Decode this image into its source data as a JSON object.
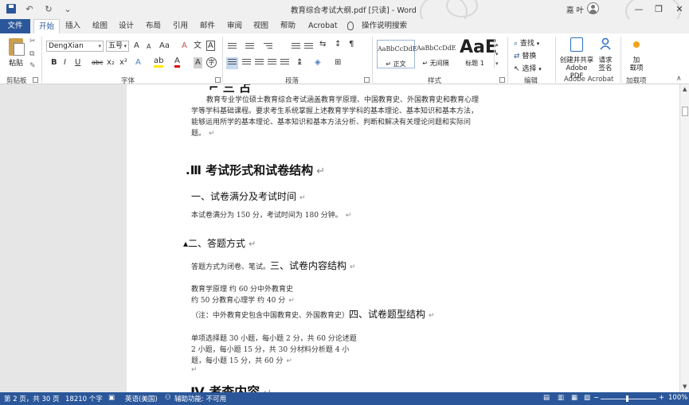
{
  "window": {
    "title": "教育综合考试大纲.pdf [只读] - Word",
    "user": "嘉 叶",
    "controls": {
      "minimize": "—",
      "restore": "❐",
      "close": "✕"
    }
  },
  "qat": {
    "undo": "↶",
    "redo": "↻",
    "more": "⌄"
  },
  "tabs": [
    "文件",
    "开始",
    "插入",
    "绘图",
    "设计",
    "布局",
    "引用",
    "邮件",
    "审阅",
    "视图",
    "帮助",
    "Acrobat",
    "操作说明搜索"
  ],
  "ribbon": {
    "clipboard": {
      "paste": "粘贴",
      "label": "剪贴板"
    },
    "font": {
      "name": "DengXian",
      "size": "五号",
      "grow": "A",
      "shrink": "A",
      "case": "Aa",
      "clear": "A",
      "phonetic": "文",
      "border_char": "A",
      "bold": "B",
      "italic": "I",
      "underline": "U",
      "strike": "abc",
      "subscript": "x₂",
      "superscript": "x²",
      "effects": "A",
      "highlight": "ab",
      "color": "A",
      "shade": "A",
      "circle": "字",
      "label": "字体"
    },
    "paragraph": {
      "label": "段落"
    },
    "styles": {
      "items": [
        {
          "sample": "AaBbCcDdE",
          "name": "↵ 正文"
        },
        {
          "sample": "AaBbCcDdE",
          "name": "↵ 无间隔"
        },
        {
          "sample": "AaE",
          "name": "标题 1"
        }
      ],
      "label": "样式"
    },
    "editing": {
      "find": "查找",
      "replace": "替换",
      "select": "选择",
      "label": "编辑"
    },
    "acrobat": {
      "create_line1": "创建并共享",
      "create_line2": "Adobe PDF",
      "sign_line1": "请求",
      "sign_line2": "签名",
      "label": "Adobe Acrobat"
    },
    "addins": {
      "line1": "加",
      "line2": "载项",
      "label": "加载项"
    }
  },
  "document": {
    "intro_lines": [
      "教育专业学位硕士教育综合考试涵盖教育学原理、中国教育史、外国教育史和教育心理",
      "学等学科基础课程。要求考生系统掌握上述教育学学科的基本理论、基本知识和基本方法，",
      "能够运用所学的基本理论、基本知识和基本方法分析、判断和解决有关理论问题和实际问",
      "题。"
    ],
    "section3_title": "Ⅲ 考试形式和试卷结构",
    "h_full_marks": "一、试卷满分及考试时间",
    "full_marks_text": "本试卷满分为 150 分，考试时间为 180 分钟。",
    "h_answer_mode": "二、答题方式",
    "answer_mode_text": "答题方式为闭卷、笔试。",
    "h_content": "三、试卷内容结构",
    "content_line1": "教育学原理      约  60 分中外教育史",
    "content_line2": "约  50 分教育心理学        约  40 分",
    "content_note": "（注：中外教育史包含中国教育史、外国教育史）",
    "h_question_types": "四、试卷题型结构",
    "types_line1": "单项选择题            30 小题，每小题 2 分，共 60 分论述题",
    "types_line2": "2 小题，每小题 15 分，共 30 分材料分析题            4 小",
    "types_line3": "题，每小题 15 分，共 60 分",
    "section4_title": "Ⅳ 考查内容",
    "para_mark": "↵"
  },
  "status": {
    "page": "第 2 页，共 30 页",
    "words": "18210 个字",
    "language": "英语(美国)",
    "accessibility": "辅助功能: 不可用",
    "zoom": "100%"
  }
}
